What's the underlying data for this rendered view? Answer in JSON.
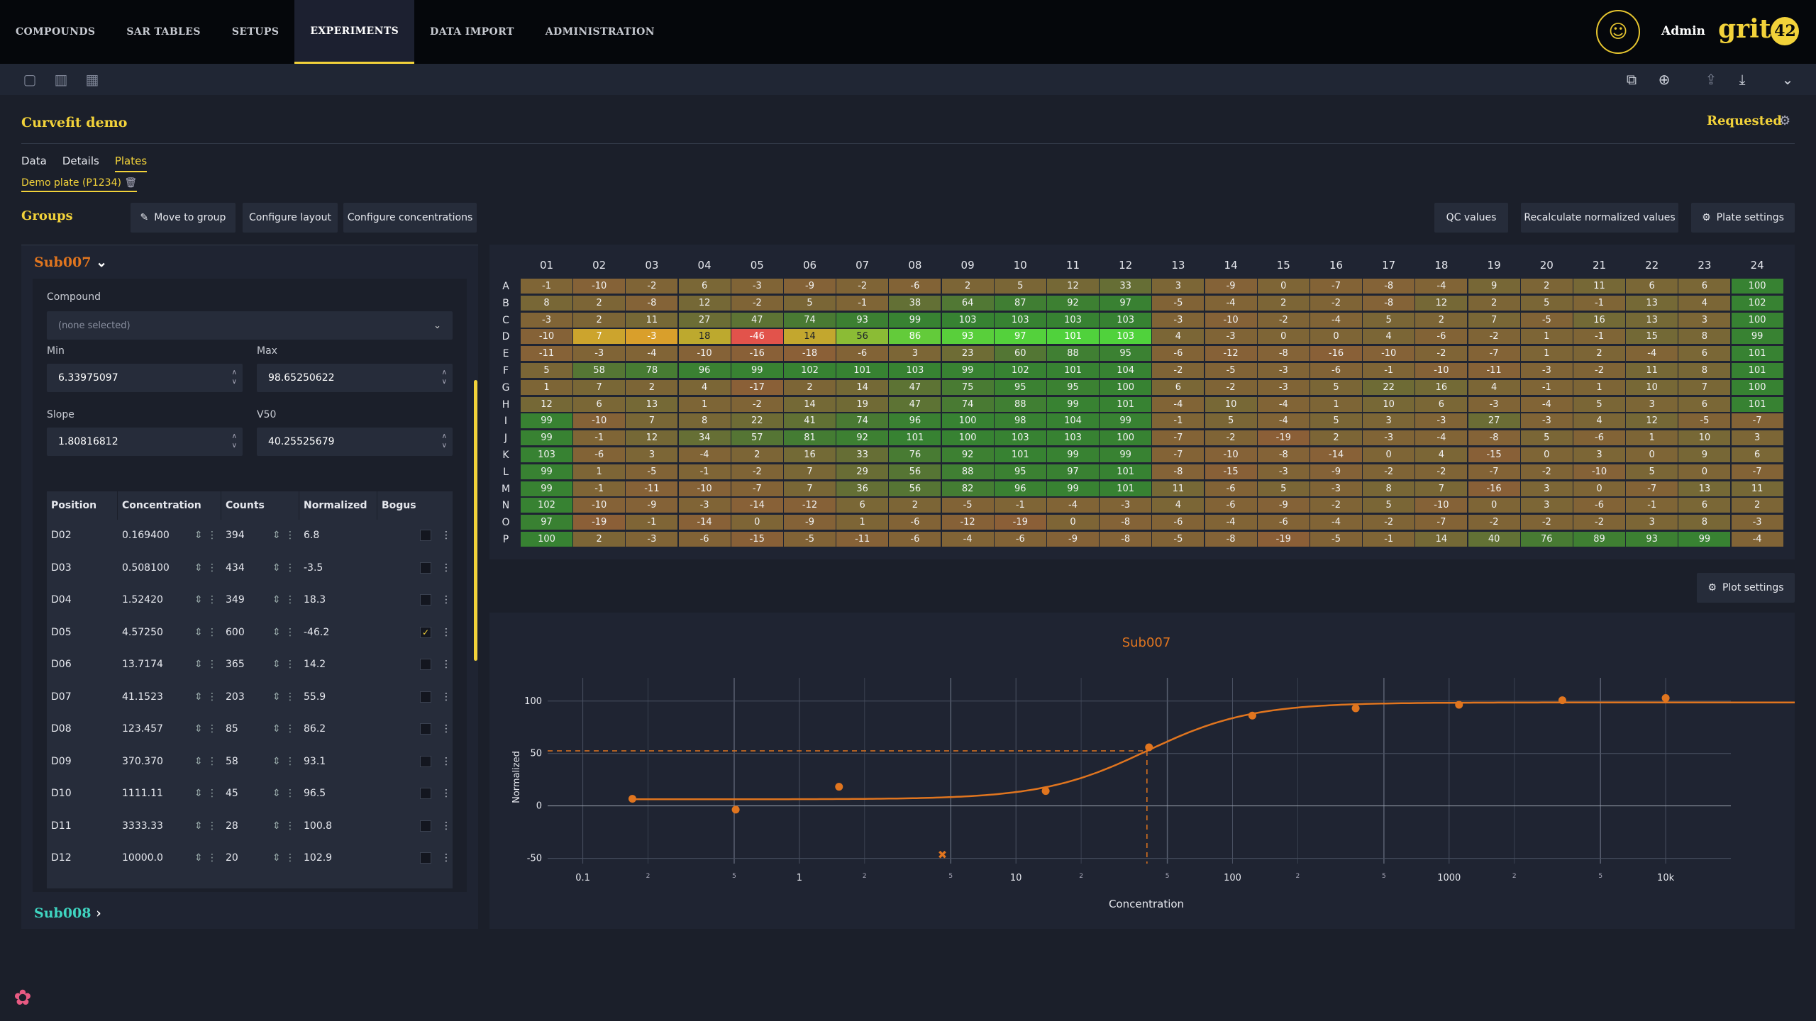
{
  "nav": {
    "items": [
      "COMPOUNDS",
      "SAR TABLES",
      "SETUPS",
      "EXPERIMENTS",
      "DATA IMPORT",
      "ADMINISTRATION"
    ],
    "active": "EXPERIMENTS"
  },
  "user": {
    "name": "Admin",
    "logo_text": "grit",
    "logo_badge": "42"
  },
  "experiment": {
    "title": "Curvefit demo",
    "status": "Requested"
  },
  "tabs": [
    "Data",
    "Details",
    "Plates"
  ],
  "active_tab": "Plates",
  "plate_chip": "Demo plate (P1234)",
  "groups_label": "Groups",
  "buttons": {
    "move": "Move to group",
    "layout": "Configure layout",
    "conc": "Configure concentrations",
    "qc": "QC values",
    "recalc": "Recalculate normalized values",
    "plate_settings": "Plate settings",
    "plot_settings": "Plot settings"
  },
  "groups": [
    {
      "name": "Sub007",
      "color": "#e0751f"
    },
    {
      "name": "Sub008",
      "color": "#3fd4c0"
    }
  ],
  "form": {
    "compound_label": "Compound",
    "compound_value": "(none selected)",
    "min_label": "Min",
    "min_value": "6.33975097",
    "max_label": "Max",
    "max_value": "98.65250622",
    "slope_label": "Slope",
    "slope_value": "1.80816812",
    "v50_label": "V50",
    "v50_value": "40.25525679"
  },
  "well_columns": [
    "Position",
    "Concentration",
    "Counts",
    "Normalized",
    "Bogus"
  ],
  "wells": [
    {
      "pos": "D02",
      "conc": "0.169400",
      "counts": "394",
      "norm": "6.8",
      "bogus": false
    },
    {
      "pos": "D03",
      "conc": "0.508100",
      "counts": "434",
      "norm": "-3.5",
      "bogus": false
    },
    {
      "pos": "D04",
      "conc": "1.52420",
      "counts": "349",
      "norm": "18.3",
      "bogus": false
    },
    {
      "pos": "D05",
      "conc": "4.57250",
      "counts": "600",
      "norm": "-46.2",
      "bogus": true
    },
    {
      "pos": "D06",
      "conc": "13.7174",
      "counts": "365",
      "norm": "14.2",
      "bogus": false
    },
    {
      "pos": "D07",
      "conc": "41.1523",
      "counts": "203",
      "norm": "55.9",
      "bogus": false
    },
    {
      "pos": "D08",
      "conc": "123.457",
      "counts": "85",
      "norm": "86.2",
      "bogus": false
    },
    {
      "pos": "D09",
      "conc": "370.370",
      "counts": "58",
      "norm": "93.1",
      "bogus": false
    },
    {
      "pos": "D10",
      "conc": "1111.11",
      "counts": "45",
      "norm": "96.5",
      "bogus": false
    },
    {
      "pos": "D11",
      "conc": "3333.33",
      "counts": "28",
      "norm": "100.8",
      "bogus": false
    },
    {
      "pos": "D12",
      "conc": "10000.0",
      "counts": "20",
      "norm": "102.9",
      "bogus": false
    }
  ],
  "plate": {
    "columns": [
      "01",
      "02",
      "03",
      "04",
      "05",
      "06",
      "07",
      "08",
      "09",
      "10",
      "11",
      "12",
      "13",
      "14",
      "15",
      "16",
      "17",
      "18",
      "19",
      "20",
      "21",
      "22",
      "23",
      "24"
    ],
    "rows": [
      "A",
      "B",
      "C",
      "D",
      "E",
      "F",
      "G",
      "H",
      "I",
      "J",
      "K",
      "L",
      "M",
      "N",
      "O",
      "P"
    ],
    "values": [
      [
        -1,
        -10,
        -2,
        6,
        -3,
        -9,
        -2,
        -6,
        2,
        5,
        12,
        33,
        3,
        -9,
        0,
        -7,
        -8,
        -4,
        9,
        2,
        11,
        6,
        6,
        100
      ],
      [
        8,
        2,
        -8,
        12,
        -2,
        5,
        -1,
        38,
        64,
        87,
        92,
        97,
        -5,
        -4,
        2,
        -2,
        -8,
        12,
        2,
        5,
        -1,
        13,
        4,
        102
      ],
      [
        -3,
        2,
        11,
        27,
        47,
        74,
        93,
        99,
        103,
        103,
        103,
        103,
        -3,
        -10,
        -2,
        -4,
        5,
        2,
        7,
        -5,
        16,
        13,
        3,
        100
      ],
      [
        -10,
        7,
        -3,
        18,
        -46,
        14,
        56,
        86,
        93,
        97,
        101,
        103,
        4,
        -3,
        0,
        0,
        4,
        -6,
        -2,
        1,
        -1,
        15,
        8,
        99
      ],
      [
        -11,
        -3,
        -4,
        -10,
        -16,
        -18,
        -6,
        3,
        23,
        60,
        88,
        95,
        -6,
        -12,
        -8,
        -16,
        -10,
        -2,
        -7,
        1,
        2,
        -4,
        6,
        101
      ],
      [
        5,
        58,
        78,
        96,
        99,
        102,
        101,
        103,
        99,
        102,
        101,
        104,
        -2,
        -5,
        -3,
        -6,
        -1,
        -10,
        -11,
        -3,
        -2,
        11,
        8,
        101
      ],
      [
        1,
        7,
        2,
        4,
        -17,
        2,
        14,
        47,
        75,
        95,
        95,
        100,
        6,
        -2,
        -3,
        5,
        22,
        16,
        4,
        -1,
        1,
        10,
        7,
        100
      ],
      [
        12,
        6,
        13,
        1,
        -2,
        14,
        19,
        47,
        74,
        88,
        99,
        101,
        -4,
        10,
        -4,
        1,
        10,
        6,
        -3,
        -4,
        5,
        3,
        6,
        101
      ],
      [
        99,
        -10,
        7,
        8,
        22,
        41,
        74,
        96,
        100,
        98,
        104,
        99,
        -1,
        5,
        -4,
        5,
        3,
        -3,
        27,
        -3,
        4,
        12,
        -5,
        -7
      ],
      [
        99,
        -1,
        12,
        34,
        57,
        81,
        92,
        101,
        100,
        103,
        103,
        100,
        -7,
        -2,
        -19,
        2,
        -3,
        -4,
        -8,
        5,
        -6,
        1,
        10,
        3
      ],
      [
        103,
        -6,
        3,
        -4,
        2,
        16,
        33,
        76,
        92,
        101,
        99,
        99,
        -7,
        -10,
        -8,
        -14,
        0,
        4,
        -15,
        0,
        3,
        0,
        9,
        6
      ],
      [
        99,
        1,
        -5,
        -1,
        -2,
        7,
        29,
        56,
        88,
        95,
        97,
        101,
        -8,
        -15,
        -3,
        -9,
        -2,
        -2,
        -7,
        -2,
        -10,
        5,
        0,
        -7
      ],
      [
        99,
        -1,
        -11,
        -10,
        -7,
        7,
        36,
        56,
        82,
        96,
        99,
        101,
        11,
        -6,
        5,
        -3,
        8,
        7,
        -16,
        3,
        0,
        -7,
        13,
        11
      ],
      [
        102,
        -10,
        -9,
        -3,
        -14,
        -12,
        6,
        2,
        -5,
        -1,
        -4,
        -3,
        4,
        -6,
        -9,
        -2,
        5,
        -10,
        0,
        3,
        -6,
        -1,
        6,
        2
      ],
      [
        97,
        -19,
        -1,
        -14,
        0,
        -9,
        1,
        -6,
        -12,
        -19,
        0,
        -8,
        -6,
        -4,
        -6,
        -4,
        -2,
        -7,
        -2,
        -2,
        -2,
        3,
        8,
        -3
      ],
      [
        100,
        2,
        -3,
        -6,
        -15,
        -5,
        -11,
        -6,
        -4,
        -6,
        -9,
        -8,
        -5,
        -8,
        -19,
        -5,
        -1,
        14,
        40,
        76,
        89,
        93,
        99,
        -4
      ]
    ],
    "highlight_row": "D"
  },
  "chart_data": {
    "type": "scatter",
    "title": "Sub007",
    "xlabel": "Concentration",
    "ylabel": "Normalized",
    "x_scale": "log",
    "xlim": [
      0.08,
      20000
    ],
    "ylim": [
      -55,
      110
    ],
    "yticks": [
      -50,
      0,
      50,
      100
    ],
    "xtick_major": [
      "0.1",
      "1",
      "10",
      "100",
      "1000",
      "10k"
    ],
    "xtick_minor": [
      "2",
      "5"
    ],
    "points": [
      {
        "x": 0.1694,
        "y": 6.8
      },
      {
        "x": 0.5081,
        "y": -3.5
      },
      {
        "x": 1.5242,
        "y": 18.3
      },
      {
        "x": 13.7174,
        "y": 14.2
      },
      {
        "x": 41.1523,
        "y": 55.9
      },
      {
        "x": 123.457,
        "y": 86.2
      },
      {
        "x": 370.37,
        "y": 93.1
      },
      {
        "x": 1111.11,
        "y": 96.5
      },
      {
        "x": 3333.33,
        "y": 100.8
      },
      {
        "x": 10000,
        "y": 102.9
      }
    ],
    "excluded": [
      {
        "x": 4.5725,
        "y": -46.2
      }
    ],
    "fit": {
      "min": 6.33975097,
      "max": 98.65250622,
      "slope": 1.80816812,
      "v50": 40.25525679
    },
    "grid": true,
    "color": "#e0751f"
  }
}
